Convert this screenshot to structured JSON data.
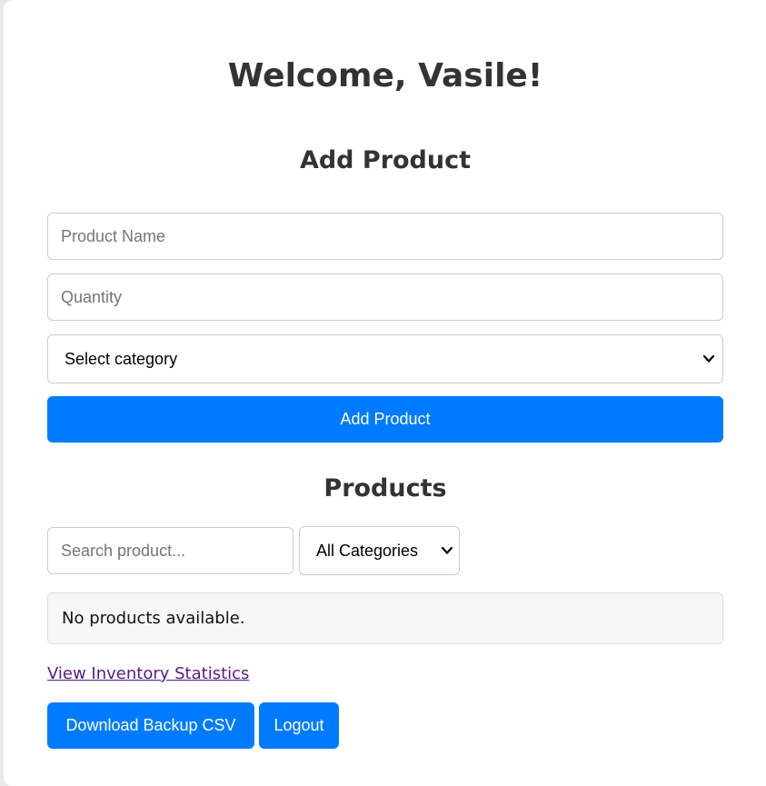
{
  "header": {
    "welcome": "Welcome, Vasile!"
  },
  "add_product": {
    "title": "Add Product",
    "name_placeholder": "Product Name",
    "name_value": "",
    "quantity_placeholder": "Quantity",
    "quantity_value": "",
    "category_selected": "Select category",
    "submit_label": "Add Product"
  },
  "products": {
    "title": "Products",
    "search_placeholder": "Search product...",
    "search_value": "",
    "filter_selected": "All Categories",
    "empty_message": "No products available."
  },
  "footer": {
    "stats_link": "View Inventory Statistics",
    "download_label": "Download Backup CSV",
    "logout_label": "Logout"
  },
  "colors": {
    "primary": "#007bff",
    "heading": "#333333",
    "visited_link": "#551a8b",
    "border": "#cccccc",
    "empty_background": "#f7f7f7"
  },
  "icons": {
    "select_arrow": "chevron-down-icon"
  }
}
